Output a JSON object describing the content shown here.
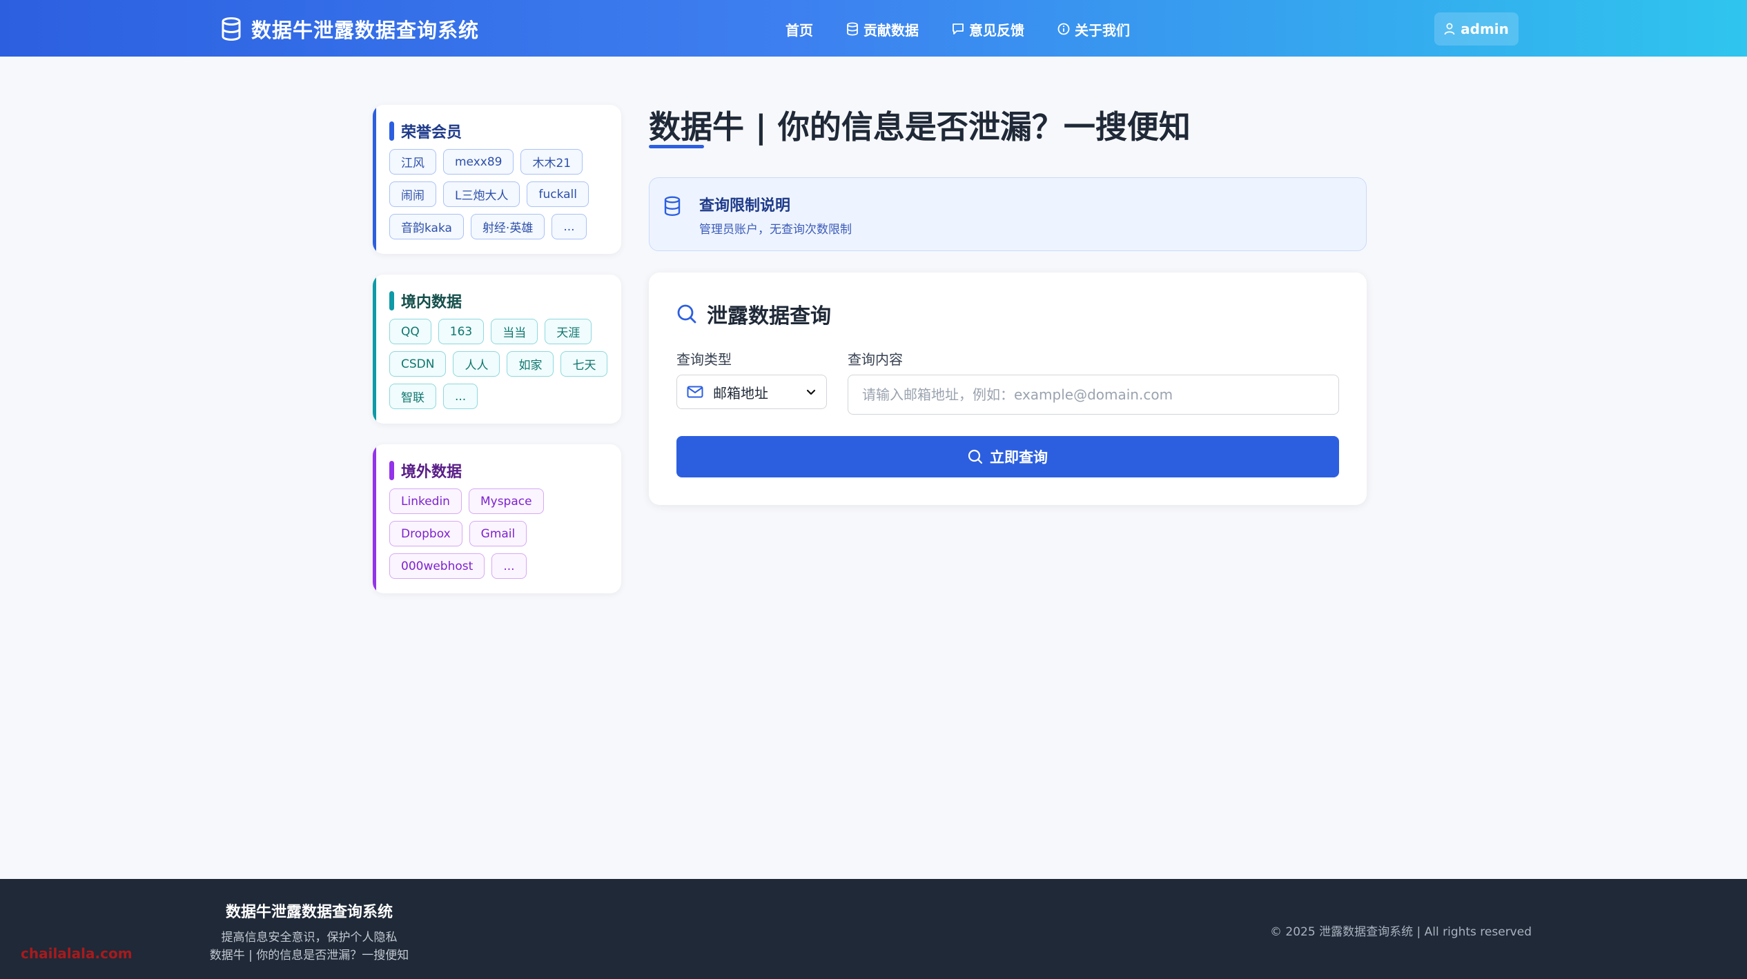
{
  "header": {
    "brand": "数据牛泄露数据查询系统",
    "nav": [
      {
        "label": "首页",
        "icon": "none"
      },
      {
        "label": "贡献数据",
        "icon": "database-icon"
      },
      {
        "label": "意见反馈",
        "icon": "chat-icon"
      },
      {
        "label": "关于我们",
        "icon": "info-icon"
      }
    ],
    "user": "admin"
  },
  "sidebar": {
    "vip": {
      "title": "荣誉会员",
      "accent": "#2c5fe0",
      "tags": [
        "江风",
        "mexx89",
        "木木21",
        "闹闹",
        "L三炮大人",
        "fuckall",
        "音韵kaka",
        "射经·英雄",
        "..."
      ]
    },
    "domestic": {
      "title": "境内数据",
      "accent": "#0e9aa7",
      "tags": [
        "QQ",
        "163",
        "当当",
        "天涯",
        "CSDN",
        "人人",
        "如家",
        "七天",
        "智联",
        "..."
      ]
    },
    "foreign": {
      "title": "境外数据",
      "accent": "#9333ea",
      "tags": [
        "Linkedin",
        "Myspace",
        "Dropbox",
        "Gmail",
        "000webhost",
        "..."
      ]
    }
  },
  "main": {
    "title": "数据牛 | 你的信息是否泄漏？一搜便知",
    "notice": {
      "title": "查询限制说明",
      "text": "管理员账户，无查询次数限制"
    },
    "query": {
      "title": "泄露数据查询",
      "type_label": "查询类型",
      "type_value": "邮箱地址",
      "content_label": "查询内容",
      "placeholder": "请输入邮箱地址，例如：example@domain.com",
      "submit": "立即查询"
    }
  },
  "footer": {
    "title": "数据牛泄露数据查询系统",
    "line1": "提高信息安全意识，保护个人隐私",
    "line2": "数据牛 | 你的信息是否泄漏？一搜便知",
    "copyright": "© 2025 泄露数据查询系统 | All rights reserved",
    "watermark": "chailalala.com"
  }
}
